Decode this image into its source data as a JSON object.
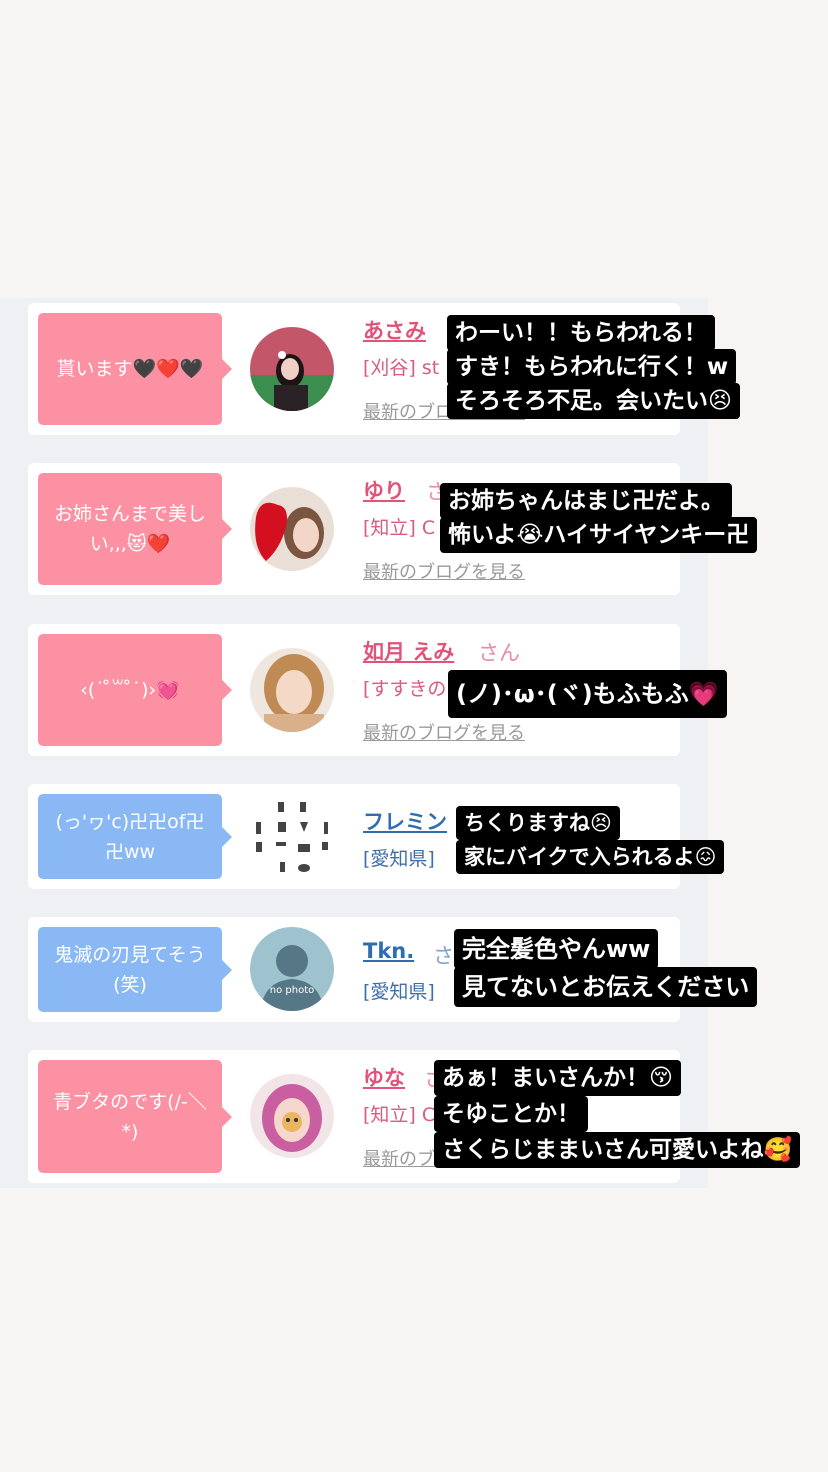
{
  "cards": [
    {
      "bubble": "貰います🖤❤️🖤",
      "name": "あさみ",
      "san": "",
      "location": "[刈谷] st",
      "blog": "最新のブログを見る",
      "captions": [
        "わーい！！もらわれる！",
        "すき！もらわれに行く！w",
        "そろそろ不足。会いたい😣"
      ]
    },
    {
      "bubble": "お姉さんまで美しい,,,😻❤️",
      "name": "ゆり",
      "san": "さ",
      "location": "[知立] C",
      "blog": "最新のブログを見る",
      "captions": [
        "お姉ちゃんはまじ卍だよ。",
        "怖いよ😭ハイサイヤンキー卍"
      ]
    },
    {
      "bubble": "‹(˙ ̊꒳ ̊˙)›💓",
      "name": "如月 えみ",
      "san": "さん",
      "location": "[すすきの",
      "blog": "最新のブログを見る",
      "captions": [
        "(ノ)･ω･(ヾ)もふもふ💗"
      ]
    },
    {
      "bubble": "(っ'ヮ'c)卍卍of卍卍ww",
      "name": "フレミン",
      "san": "",
      "location": "[愛知県]",
      "blog": "",
      "captions": [
        "ちくりますね😣",
        "家にバイクで入られるよ😖"
      ]
    },
    {
      "bubble": "鬼滅の刃見てそう(笑)",
      "name": "Tkn.",
      "san": "さ",
      "location": "[愛知県]",
      "blog": "",
      "avatar_text": "no photo",
      "captions": [
        "完全髪色やんww",
        "見てないとお伝えください"
      ]
    },
    {
      "bubble": "青ブタのです(/-＼*)",
      "name": "ゆな",
      "san": "さ",
      "location": "[知立] C",
      "blog": "最新のブ",
      "captions": [
        "あぁ！まいさんか！😚",
        "そゆことか！",
        "さくらじままいさん可愛いよね🥰"
      ]
    }
  ],
  "colors": {
    "pink_bubble": "#fd91a4",
    "blue_bubble": "#8ab8f5",
    "pink_name": "#e2537a",
    "blue_name": "#2f6db0"
  }
}
